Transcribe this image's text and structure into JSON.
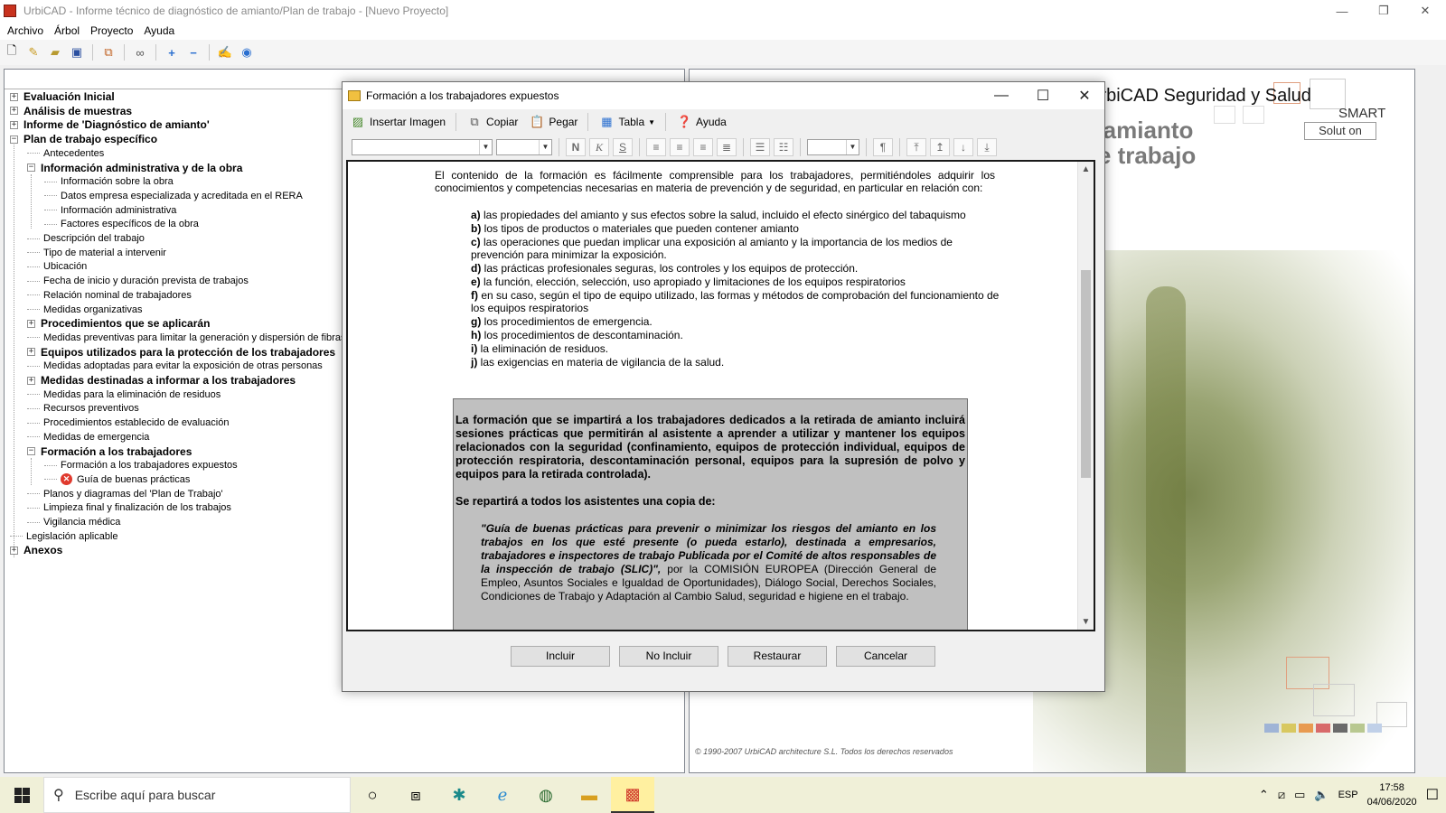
{
  "window": {
    "title": "UrbiCAD - Informe técnico de diagnóstico de amianto/Plan de trabajo  - [Nuevo Proyecto]",
    "minimize": "—",
    "maximize": "❐",
    "close": "✕"
  },
  "menu": [
    "Archivo",
    "Árbol",
    "Proyecto",
    "Ayuda"
  ],
  "toolbar_icons": [
    "new-file-icon",
    "wand-icon",
    "open-folder-icon",
    "save-icon",
    "copy-icon",
    "link-icon",
    "expand-all-icon",
    "collapse-all-icon",
    "edit-check-icon",
    "help-icon"
  ],
  "tree": [
    {
      "label": "Evaluación Inicial",
      "level": 0,
      "bold": true,
      "expander": "+"
    },
    {
      "label": "Análisis de muestras",
      "level": 0,
      "bold": true,
      "expander": "+"
    },
    {
      "label": "Informe de 'Diagnóstico de amianto'",
      "level": 0,
      "bold": true,
      "expander": "+"
    },
    {
      "label": "Plan de trabajo específico",
      "level": 0,
      "bold": true,
      "expander": "−"
    },
    {
      "label": "Antecedentes",
      "level": 1,
      "bold": false
    },
    {
      "label": "Información administrativa y de la obra",
      "level": 1,
      "bold": true,
      "expander": "−"
    },
    {
      "label": "Información sobre la obra",
      "level": 2,
      "bold": false
    },
    {
      "label": "Datos empresa especializada y acreditada en el RERA",
      "level": 2,
      "bold": false
    },
    {
      "label": "Información administrativa",
      "level": 2,
      "bold": false
    },
    {
      "label": "Factores específicos de la obra",
      "level": 2,
      "bold": false
    },
    {
      "label": "Descripción del trabajo",
      "level": 1,
      "bold": false
    },
    {
      "label": "Tipo de material a intervenir",
      "level": 1,
      "bold": false
    },
    {
      "label": "Ubicación",
      "level": 1,
      "bold": false
    },
    {
      "label": "Fecha de inicio y duración prevista de trabajos",
      "level": 1,
      "bold": false
    },
    {
      "label": "Relación nominal de trabajadores",
      "level": 1,
      "bold": false
    },
    {
      "label": "Medidas organizativas",
      "level": 1,
      "bold": false
    },
    {
      "label": "Procedimientos que se aplicarán",
      "level": 1,
      "bold": true,
      "expander": "+"
    },
    {
      "label": "Medidas preventivas para limitar la generación y dispersión de fibras",
      "level": 1,
      "bold": false
    },
    {
      "label": "Equipos utilizados para la protección de los trabajadores",
      "level": 1,
      "bold": true,
      "expander": "+"
    },
    {
      "label": "Medidas adoptadas para evitar la exposición de otras personas",
      "level": 1,
      "bold": false
    },
    {
      "label": "Medidas destinadas a informar a los trabajadores",
      "level": 1,
      "bold": true,
      "expander": "+"
    },
    {
      "label": "Medidas para la eliminación de residuos",
      "level": 1,
      "bold": false
    },
    {
      "label": "Recursos preventivos",
      "level": 1,
      "bold": false
    },
    {
      "label": "Procedimientos establecido de evaluación",
      "level": 1,
      "bold": false
    },
    {
      "label": "Medidas de emergencia",
      "level": 1,
      "bold": false
    },
    {
      "label": "Formación a los trabajadores",
      "level": 1,
      "bold": true,
      "expander": "−"
    },
    {
      "label": "Formación a los trabajadores expuestos",
      "level": 2,
      "bold": false
    },
    {
      "label": "Guía de buenas prácticas",
      "level": 2,
      "bold": false,
      "error": true
    },
    {
      "label": "Planos y diagramas del 'Plan de Trabajo'",
      "level": 1,
      "bold": false
    },
    {
      "label": "Limpieza final y finalización de los trabajos",
      "level": 1,
      "bold": false
    },
    {
      "label": "Vigilancia médica",
      "level": 1,
      "bold": false
    },
    {
      "label": "Legislación aplicable",
      "level": 0,
      "bold": false
    },
    {
      "label": "Anexos",
      "level": 0,
      "bold": true,
      "expander": "+"
    }
  ],
  "splash": {
    "brand": "UrbiCAD Seguridad y Salud",
    "sub1": "e amianto",
    "sub2": "de trabajo",
    "smart": "SMART",
    "solution": "Solut on",
    "copyright": "© 1990-2007 UrbiCAD architecture S.L. Todos los derechos reservados",
    "strip_colors": [
      "#9fb4d6",
      "#d8c860",
      "#e89a50",
      "#d86a6a",
      "#6a6a6a",
      "#b8c890",
      "#c0d0e8"
    ]
  },
  "dialog": {
    "title": "Formación a los trabajadores expuestos",
    "minimize": "—",
    "maximize": "☐",
    "close": "✕",
    "tools": [
      {
        "icon": "insert-image-icon",
        "label": "Insertar Imagen"
      },
      {
        "icon": "copy-icon",
        "label": "Copiar"
      },
      {
        "icon": "paste-icon",
        "label": "Pegar"
      },
      {
        "icon": "table-icon",
        "label": "Tabla"
      },
      {
        "icon": "help-icon",
        "label": "Ayuda"
      }
    ],
    "format_buttons": [
      "N",
      "K",
      "S"
    ],
    "content": {
      "intro": "El contenido de la formación es fácilmente comprensible para los trabajadores, permitiéndoles adquirir los conocimientos y competencias necesarias en materia de prevención y de seguridad, en particular en relación con:",
      "items": [
        {
          "key": "a)",
          "text": " las propiedades del amianto y sus efectos sobre la salud, incluido el efecto sinérgico del tabaquismo"
        },
        {
          "key": "b)",
          "text": " los tipos de productos o materiales que pueden contener amianto"
        },
        {
          "key": "c)",
          "text": " las operaciones que puedan implicar una exposición al amianto y la importancia de los medios de prevención para minimizar la exposición."
        },
        {
          "key": "d)",
          "text": " las prácticas profesionales seguras, los controles y los equipos de protección."
        },
        {
          "key": "e)",
          "text": " la función, elección, selección, uso apropiado y limitaciones de los equipos respiratorios"
        },
        {
          "key": "f)",
          "text": " en su caso, según el tipo de equipo utilizado, las formas y métodos de comprobación del funcionamiento de los equipos respiratorios"
        },
        {
          "key": "g)",
          "text": " los procedimientos de emergencia."
        },
        {
          "key": "h)",
          "text": " los procedimientos de descontaminación."
        },
        {
          "key": "i)",
          "text": " la eliminación de residuos."
        },
        {
          "key": "j)",
          "text": " las exigencias en materia de vigilancia de la salud."
        }
      ],
      "box_paragraph": "La formación que se impartirá a los trabajadores dedicados a la retirada de amianto incluirá sesiones prácticas que permitirán al asistente a aprender a utilizar y mantener los equipos relacionados con la seguridad (confinamiento, equipos de protección individual, equipos de protección respiratoria, descontaminación personal, equipos para la supresión de polvo y equipos para la retirada controlada).",
      "copy_of": "Se repartirá a todos los asistentes una copia de:",
      "citation_title": "\"Guía de buenas prácticas para prevenir o minimizar los riesgos del amianto en los trabajos en los que esté presente (o pueda estarlo), destinada a empresarios, trabajadores e inspectores de trabajo Publicada por el Comité de altos responsables de la inspección de trabajo (SLIC)\",",
      "citation_rest": " por la COMISIÓN EUROPEA (Dirección General de Empleo, Asuntos Sociales e Igualdad de Oportunidades), Diálogo Social, Derechos Sociales, Condiciones de Trabajo y Adaptación al Cambio Salud, seguridad e higiene en el trabajo."
    },
    "buttons": [
      "Incluir",
      "No Incluir",
      "Restaurar",
      "Cancelar"
    ]
  },
  "taskbar": {
    "search_placeholder": "Escribe aquí para buscar",
    "apps": [
      "cortana-icon",
      "task-view-icon",
      "app-star-icon",
      "edge-icon",
      "app-globe-icon",
      "file-explorer-icon",
      "urbicad-icon"
    ],
    "lang": "ESP",
    "time": "17:58",
    "date": "04/06/2020"
  }
}
